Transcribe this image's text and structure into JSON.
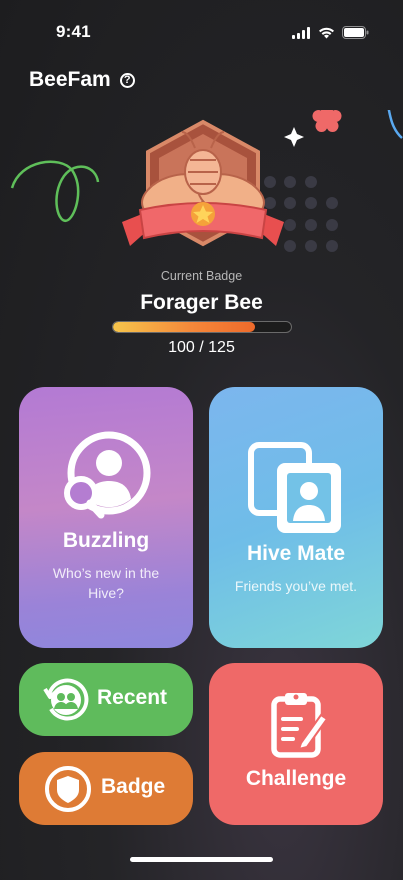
{
  "status_bar": {
    "time": "9:41"
  },
  "header": {
    "title": "BeeFam",
    "help_icon": "?"
  },
  "badge": {
    "caption": "Current Badge",
    "name": "Forager Bee",
    "progress_text": "100 / 125",
    "progress_fraction": 0.8,
    "icon": "bee-medal-icon"
  },
  "cards": {
    "buzzling": {
      "title": "Buzzling",
      "subtitle": "Who’s new in the Hive?",
      "icon": "user-search-icon"
    },
    "hive_mate": {
      "title": "Hive Mate",
      "subtitle": "Friends you’ve met.",
      "icon": "photo-cards-icon"
    },
    "recent": {
      "label": "Recent",
      "icon": "history-users-icon"
    },
    "badge": {
      "label": "Badge",
      "icon": "shield-icon"
    },
    "challenge": {
      "label": "Challenge",
      "icon": "clipboard-edit-icon"
    }
  },
  "colors": {
    "buzzling": "#b37ad4",
    "hive_mate": "#7cb6ee",
    "recent": "#5fbb5c",
    "badge": "#de7b35",
    "challenge": "#ef6968",
    "progress": "#f5883a"
  }
}
